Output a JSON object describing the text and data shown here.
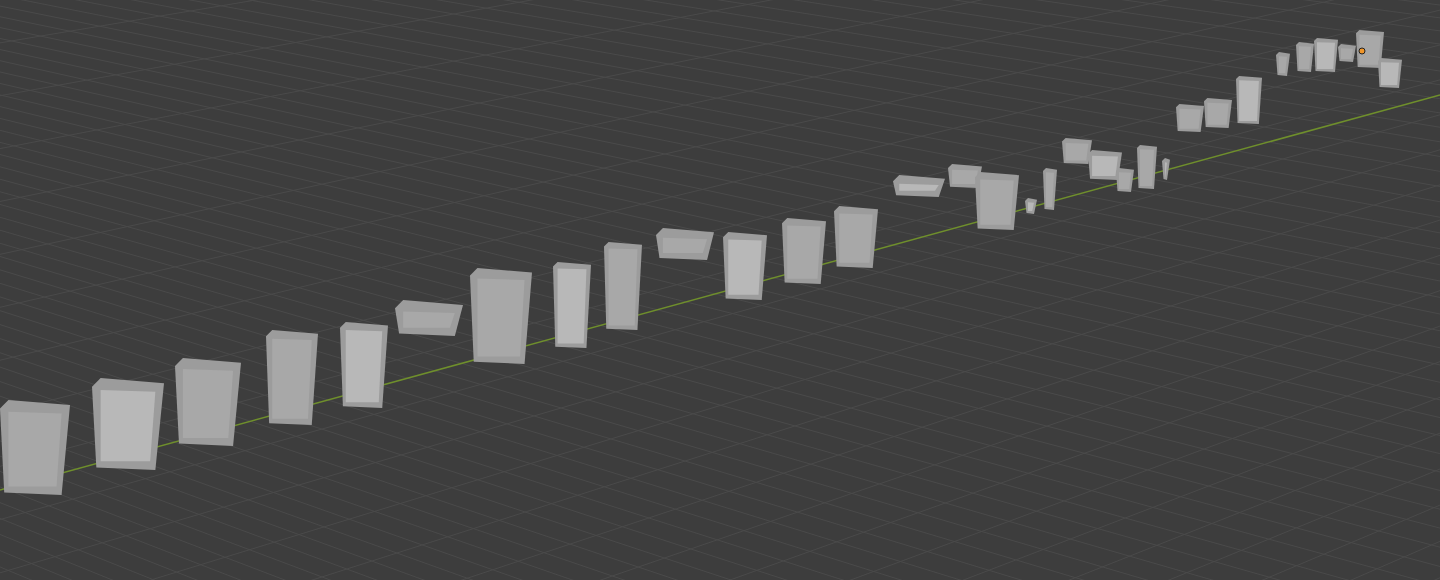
{
  "viewport": {
    "grid": true,
    "x_axis": true,
    "origin_marker": true
  }
}
